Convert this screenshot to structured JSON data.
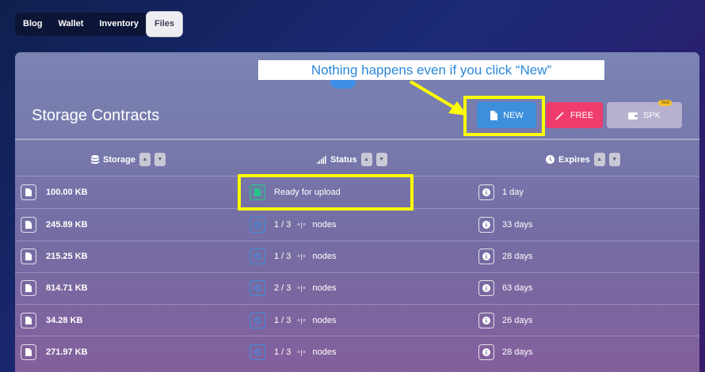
{
  "tabs": [
    {
      "label": "Blog"
    },
    {
      "label": "Wallet"
    },
    {
      "label": "Inventory"
    },
    {
      "label": "Files"
    }
  ],
  "panel": {
    "title": "Storage Contracts",
    "buttons": {
      "new_label": "NEW",
      "free_label": "FREE",
      "spk_label": "SPK",
      "spk_badge": "Test"
    }
  },
  "annotation": {
    "text": "Nothing happens even if you click “New”",
    "color": "#ffff00"
  },
  "table": {
    "columns": [
      {
        "label": "Storage",
        "icon": "database-icon"
      },
      {
        "label": "Status",
        "icon": "signal-icon"
      },
      {
        "label": "Expires",
        "icon": "clock-icon"
      }
    ],
    "rows": [
      {
        "size": "100.00 KB",
        "status": "Ready for upload",
        "status_kind": "ready",
        "expires": "1 day"
      },
      {
        "size": "245.89 KB",
        "status": "1 / 3",
        "nodes_label": "nodes",
        "status_kind": "pending",
        "expires": "33 days"
      },
      {
        "size": "215.25 KB",
        "status": "1 / 3",
        "nodes_label": "nodes",
        "status_kind": "pending",
        "expires": "28 days"
      },
      {
        "size": "814.71 KB",
        "status": "2 / 3",
        "nodes_label": "nodes",
        "status_kind": "pending",
        "expires": "63 days"
      },
      {
        "size": "34.28 KB",
        "status": "1 / 3",
        "nodes_label": "nodes",
        "status_kind": "pending",
        "expires": "26 days"
      },
      {
        "size": "271.97 KB",
        "status": "1 / 3",
        "nodes_label": "nodes",
        "status_kind": "pending",
        "expires": "28 days"
      }
    ]
  },
  "colors": {
    "new_button": "#3d8fdc",
    "free_button": "#f03c6d",
    "spk_button": "#b7b0cf",
    "ready_icon": "#27c48c",
    "pending_icon": "#3b8fe0"
  }
}
